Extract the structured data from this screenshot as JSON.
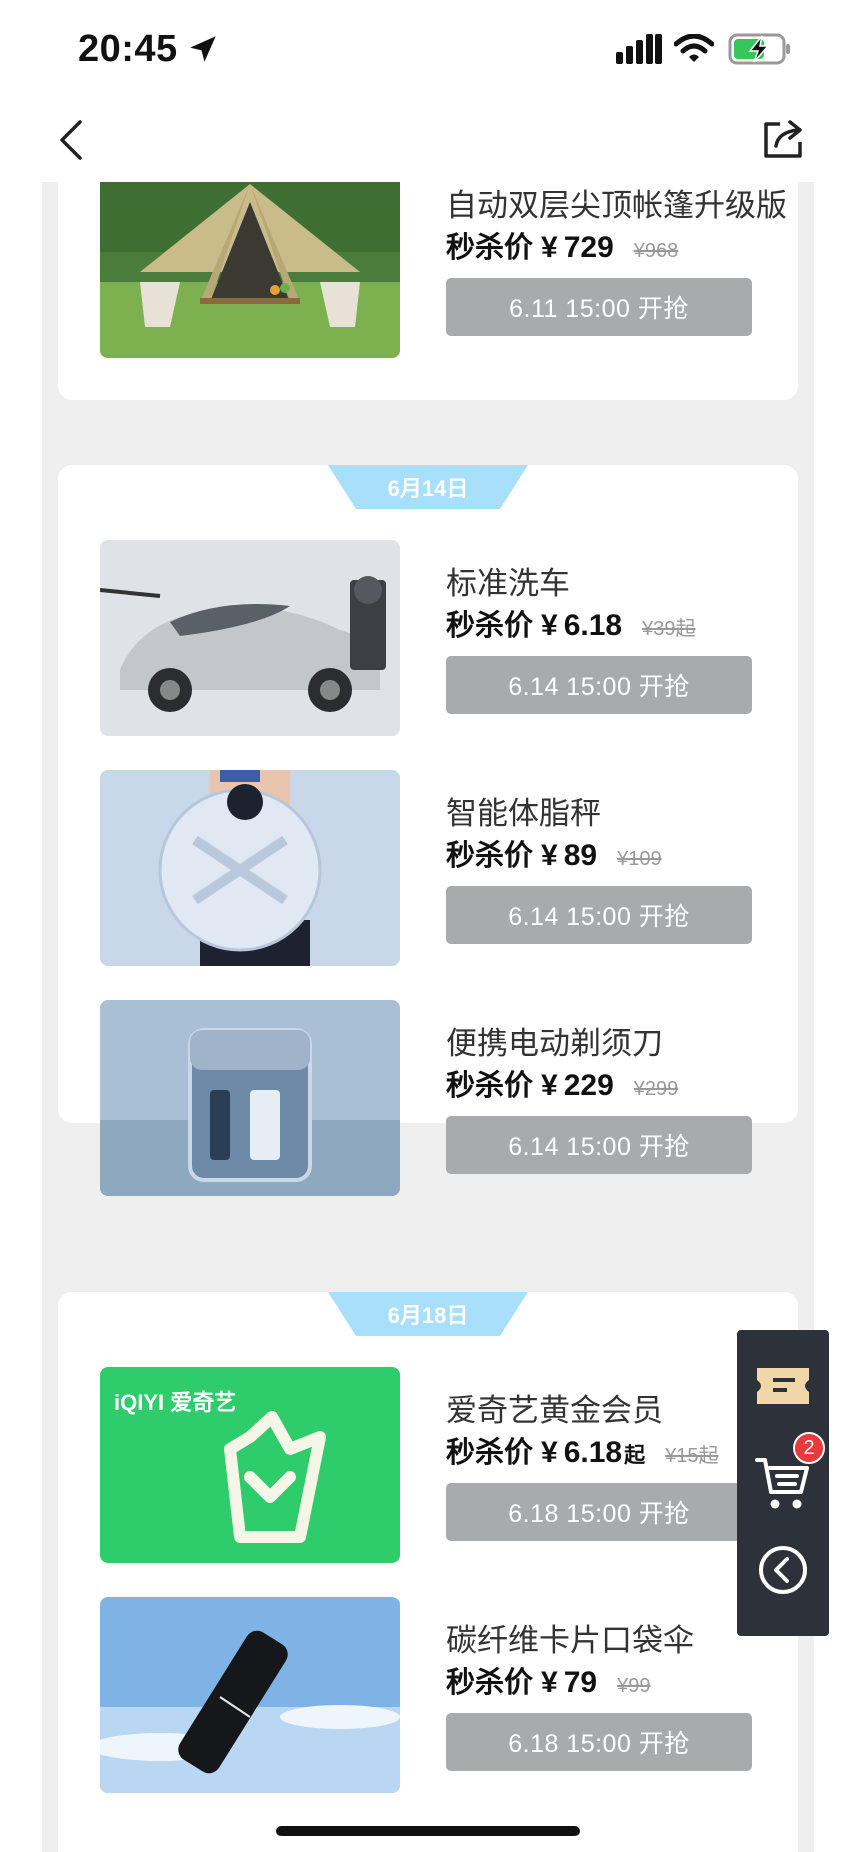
{
  "status_bar": {
    "time": "20:45"
  },
  "price_label": "秒杀价",
  "currency": "¥",
  "top_item": {
    "name": "自动双层尖顶帐篷升级版",
    "price": "729",
    "original_price": "¥968",
    "button": "6.11 15:00 开抢"
  },
  "sections": [
    {
      "date": "6月14日",
      "items": [
        {
          "name": "标准洗车",
          "price": "6.18",
          "price_suffix": "",
          "original_price": "¥39起",
          "button": "6.14 15:00 开抢"
        },
        {
          "name": "智能体脂秤",
          "price": "89",
          "price_suffix": "",
          "original_price": "¥109",
          "button": "6.14 15:00 开抢"
        },
        {
          "name": "便携电动剃须刀",
          "price": "229",
          "price_suffix": "",
          "original_price": "¥299",
          "button": "6.14 15:00 开抢"
        }
      ]
    },
    {
      "date": "6月18日",
      "items": [
        {
          "name": "爱奇艺黄金会员",
          "price": "6.18",
          "price_suffix": "起",
          "original_price": "¥15起",
          "button": "6.18 15:00 开抢",
          "thumb_logo": "iQIYI 爱奇艺"
        },
        {
          "name": "碳纤维卡片口袋伞",
          "price": "79",
          "price_suffix": "",
          "original_price": "¥99",
          "button": "6.18 15:00 开抢"
        }
      ]
    }
  ],
  "float_panel": {
    "cart_count": "2"
  },
  "icons": {
    "location": "location-arrow-icon",
    "signal": "cellular-signal-icon",
    "wifi": "wifi-icon",
    "battery": "battery-charging-icon",
    "back": "chevron-left-icon",
    "share": "share-icon",
    "coupon": "coupon-ticket-icon",
    "cart": "shopping-cart-icon",
    "collapse": "circle-chevron-left-icon"
  },
  "colors": {
    "date_tab": "#a8e0fb",
    "button_disabled": "#a9aaac",
    "float_panel": "#2c313a",
    "badge": "#e83a3a",
    "iqiyi_green": "#2ecc6a"
  }
}
